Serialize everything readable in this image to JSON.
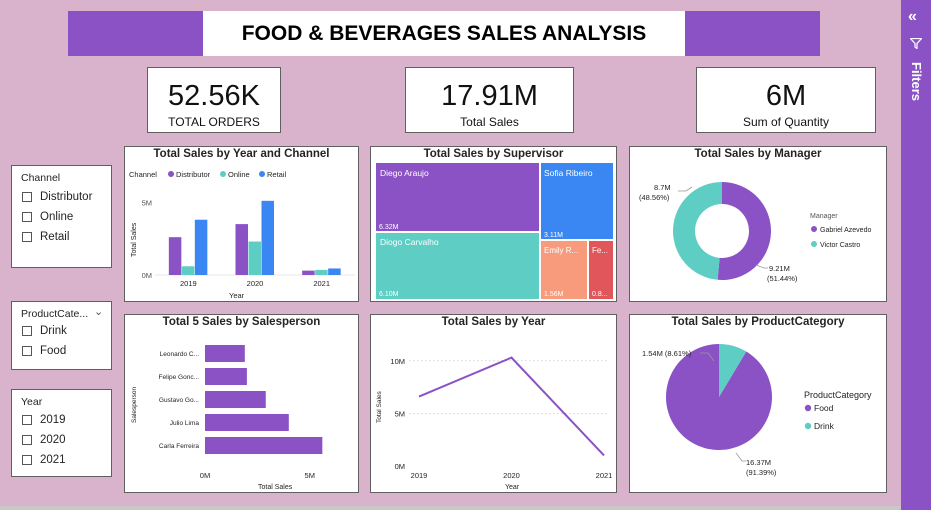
{
  "title": "FOOD & BEVERAGES SALES ANALYSIS",
  "kpis": [
    {
      "value": "52.56K",
      "label": "TOTAL ORDERS"
    },
    {
      "value": "17.91M",
      "label": "Total Sales"
    },
    {
      "value": "6M",
      "label": "Sum of Quantity"
    }
  ],
  "slicers": {
    "channel": {
      "title": "Channel",
      "items": [
        "Distributor",
        "Online",
        "Retail"
      ]
    },
    "product_category": {
      "title": "ProductCate...",
      "items": [
        "Drink",
        "Food"
      ]
    },
    "year": {
      "title": "Year",
      "items": [
        "2019",
        "2020",
        "2021"
      ]
    }
  },
  "filters_pane": {
    "label": "Filters"
  },
  "colors": {
    "purple": "#8b52c6",
    "teal": "#5ecdc4",
    "blue": "#3a86f3",
    "salmon": "#f89b7c",
    "red": "#e0565a",
    "accent_band": "#8b52c6"
  },
  "chart_data": [
    {
      "type": "bar",
      "title": "Total Sales by Year and Channel",
      "legend_title": "Channel",
      "categories": [
        "2019",
        "2020",
        "2021"
      ],
      "series": [
        {
          "name": "Distributor",
          "color": "#8b52c6",
          "values": [
            2.6,
            3.5,
            0.3
          ]
        },
        {
          "name": "Online",
          "color": "#5ecdc4",
          "values": [
            0.6,
            2.3,
            0.35
          ]
        },
        {
          "name": "Retail",
          "color": "#3a86f3",
          "values": [
            3.8,
            5.1,
            0.45
          ]
        }
      ],
      "xlabel": "Year",
      "ylabel": "Total Sales",
      "yticks": [
        "0M",
        "5M"
      ],
      "ylim": [
        0,
        5.5
      ]
    },
    {
      "type": "treemap",
      "title": "Total Sales by Supervisor",
      "items": [
        {
          "name": "Diego Araujo",
          "value": "6.32M",
          "color": "#8b52c6"
        },
        {
          "name": "Sofia Ribeiro",
          "value": "3.11M",
          "color": "#3a86f3"
        },
        {
          "name": "Diogo Carvalho",
          "value": "6.10M",
          "color": "#5ecdc4"
        },
        {
          "name": "Emily R...",
          "value": "1.56M",
          "color": "#f89b7c"
        },
        {
          "name": "Fe...",
          "value": "0.8...",
          "color": "#e0565a"
        }
      ]
    },
    {
      "type": "donut",
      "title": "Total Sales by Manager",
      "legend_title": "Manager",
      "slices": [
        {
          "name": "Gabriel Azevedo",
          "value": 9.21,
          "label": "9.21M",
          "pct": "(51.44%)",
          "color": "#8b52c6"
        },
        {
          "name": "Victor Castro",
          "value": 8.7,
          "label": "8.7M",
          "pct": "(48.56%)",
          "color": "#5ecdc4"
        }
      ]
    },
    {
      "type": "bar",
      "orientation": "horizontal",
      "title": "Total 5 Sales by Salesperson",
      "categories": [
        "Leonardo C...",
        "Felipe Gonc...",
        "Gustavo Go...",
        "Julio Lima",
        "Carla Ferreira"
      ],
      "values": [
        1.9,
        2.0,
        2.9,
        4.0,
        5.6
      ],
      "xlabel": "Total Sales",
      "ylabel": "Salesperson",
      "xticks": [
        "0M",
        "5M"
      ],
      "xlim": [
        0,
        6.3
      ]
    },
    {
      "type": "line",
      "title": "Total Sales by Year",
      "x": [
        "2019",
        "2020",
        "2021"
      ],
      "values": [
        6.6,
        10.3,
        1.0
      ],
      "xlabel": "Year",
      "ylabel": "Total Sales",
      "yticks": [
        "0M",
        "5M",
        "10M"
      ],
      "ylim": [
        0,
        11.5
      ]
    },
    {
      "type": "pie",
      "title": "Total Sales by ProductCategory",
      "legend_title": "ProductCategory",
      "slices": [
        {
          "name": "Food",
          "value": 16.37,
          "label": "16.37M",
          "pct": "(91.39%)",
          "color": "#8b52c6"
        },
        {
          "name": "Drink",
          "value": 1.54,
          "label": "1.54M (8.61%)",
          "pct": "",
          "color": "#5ecdc4"
        }
      ]
    }
  ]
}
